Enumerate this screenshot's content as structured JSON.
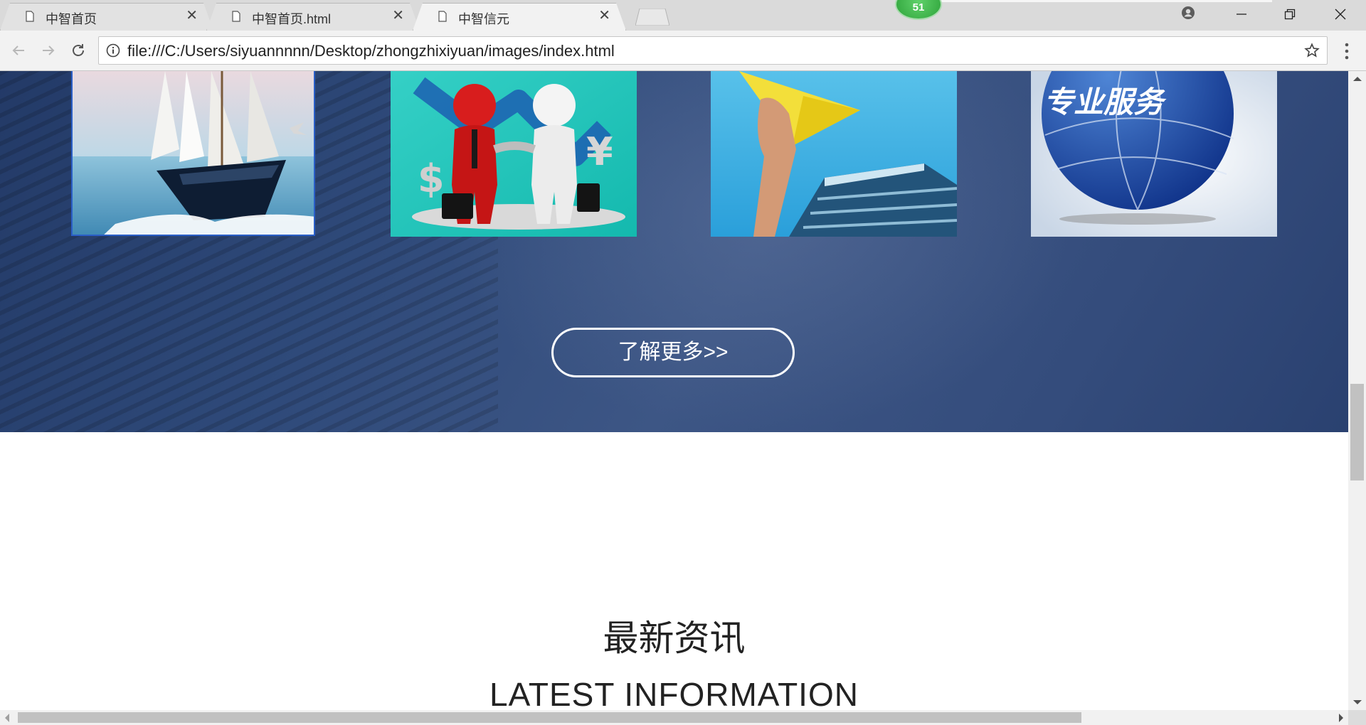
{
  "browser": {
    "tabs": [
      {
        "title": "中智首页",
        "active": false
      },
      {
        "title": "中智首页.html",
        "active": false
      },
      {
        "title": "中智信元",
        "active": true
      }
    ],
    "extension_badge": "51",
    "url": "file:///C:/Users/siyuannnnn/Desktop/zhongzhixiyuan/images/index.html",
    "icons": {
      "page": "page-icon",
      "close": "close-icon",
      "back": "back-arrow-icon",
      "forward": "forward-arrow-icon",
      "reload": "reload-icon",
      "info": "info-icon",
      "star": "star-icon",
      "menu": "kebab-menu-icon",
      "profile": "profile-icon"
    }
  },
  "page": {
    "services": [
      {
        "image": "sailboat"
      },
      {
        "image": "business-handshake"
      },
      {
        "image": "paper-plane-building"
      },
      {
        "image": "globe",
        "text": "专业服务"
      }
    ],
    "more_button": "了解更多>>",
    "news_title": "最新资讯",
    "news_subtitle": "LATEST INFORMATION"
  },
  "colors": {
    "band": "#33497a",
    "button_border": "#ffffff",
    "card_highlight": "#2a5fc8"
  }
}
